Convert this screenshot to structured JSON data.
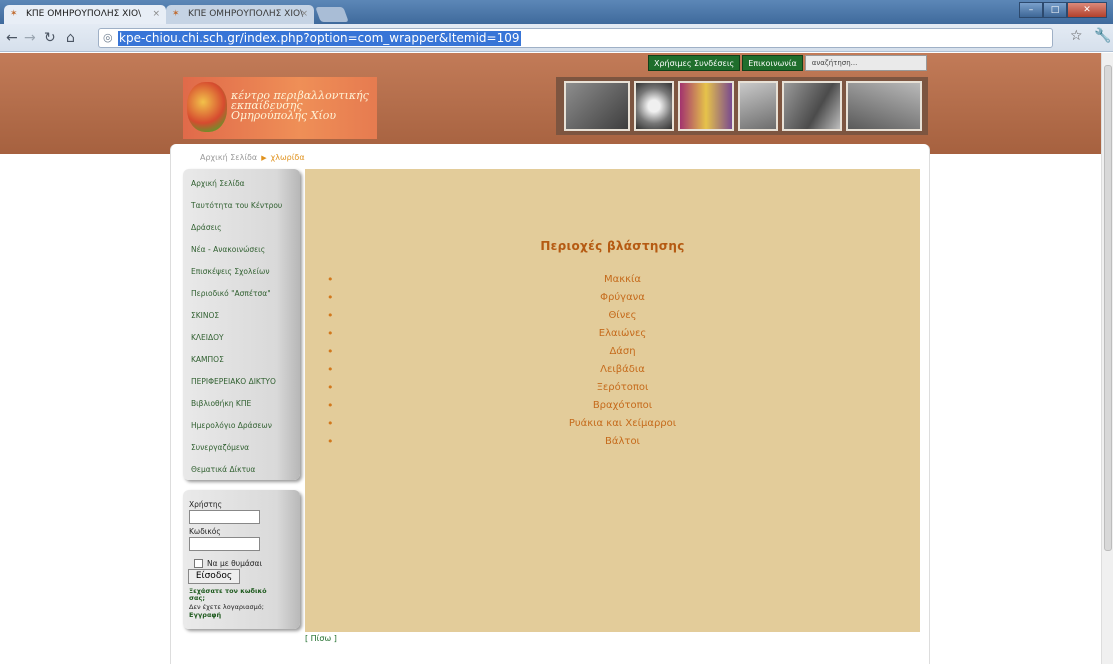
{
  "browser": {
    "tabs": [
      {
        "label": "ΚΠΕ ΟΜΗΡΟΥΠΟΛΗΣ ΧΙΟ\\"
      },
      {
        "label": "ΚΠΕ ΟΜΗΡΟΥΠΟΛΗΣ ΧΙΟ\\"
      }
    ],
    "url": "kpe-chiou.chi.sch.gr/index.php?option=com_wrapper&Itemid=109"
  },
  "topnav": {
    "links": [
      "Χρήσιμες Συνδέσεις",
      "Επικοινωνία"
    ],
    "search_placeholder": "αναζήτηση..."
  },
  "logo": {
    "lines": [
      "κέντρο περιβαλλοντικής",
      "εκπαίδευσης",
      "Ομηρούπολης Χίου"
    ]
  },
  "breadcrumb": {
    "home": "Αρχική Σελίδα",
    "current": "χλωρίδα"
  },
  "menu": {
    "items": [
      "Αρχική Σελίδα",
      "Ταυτότητα του Κέντρου",
      "Δράσεις",
      "Νέα - Ανακοινώσεις",
      "Επισκέψεις Σχολείων",
      "Περιοδικό \"Ασπέτσα\"",
      "ΣΚΙΝΟΣ",
      "ΚΛΕΙΔΟΥ",
      "ΚΑΜΠΟΣ",
      "ΠΕΡΙΦΕΡΕΙΑΚΟ ΔΙΚΤΥΟ",
      "Βιβλιοθήκη ΚΠΕ",
      "Ημερολόγιο Δράσεων",
      "Συνεργαζόμενα",
      "Θεματικά Δίκτυα"
    ]
  },
  "login": {
    "username_label": "Χρήστης",
    "password_label": "Κωδικός",
    "remember_label": "Να με θυμάσαι",
    "submit_label": "Είσοδος",
    "forgot_line1": "Ξεχάσατε τον κωδικό",
    "forgot_line2": "σας;",
    "no_account": "Δεν έχετε λογαριασμό;",
    "register": "Εγγραφή"
  },
  "content": {
    "title": "Περιοχές βλάστησης",
    "items": [
      "Μακκία",
      "Φρύγανα",
      "Θίνες",
      "Ελαιώνες",
      "Δάση",
      "Λειβάδια",
      "Ξερότοποι",
      "Βραχότοποι",
      "Ρυάκια και Χείμαρροι",
      "Βάλτοι"
    ]
  },
  "back_link": "[ Πίσω ]",
  "colors": {
    "header": "#b46c4a",
    "content_bg": "#e3cc9a",
    "content_text": "#c56a1b",
    "nav_green": "#1f6e2c"
  }
}
